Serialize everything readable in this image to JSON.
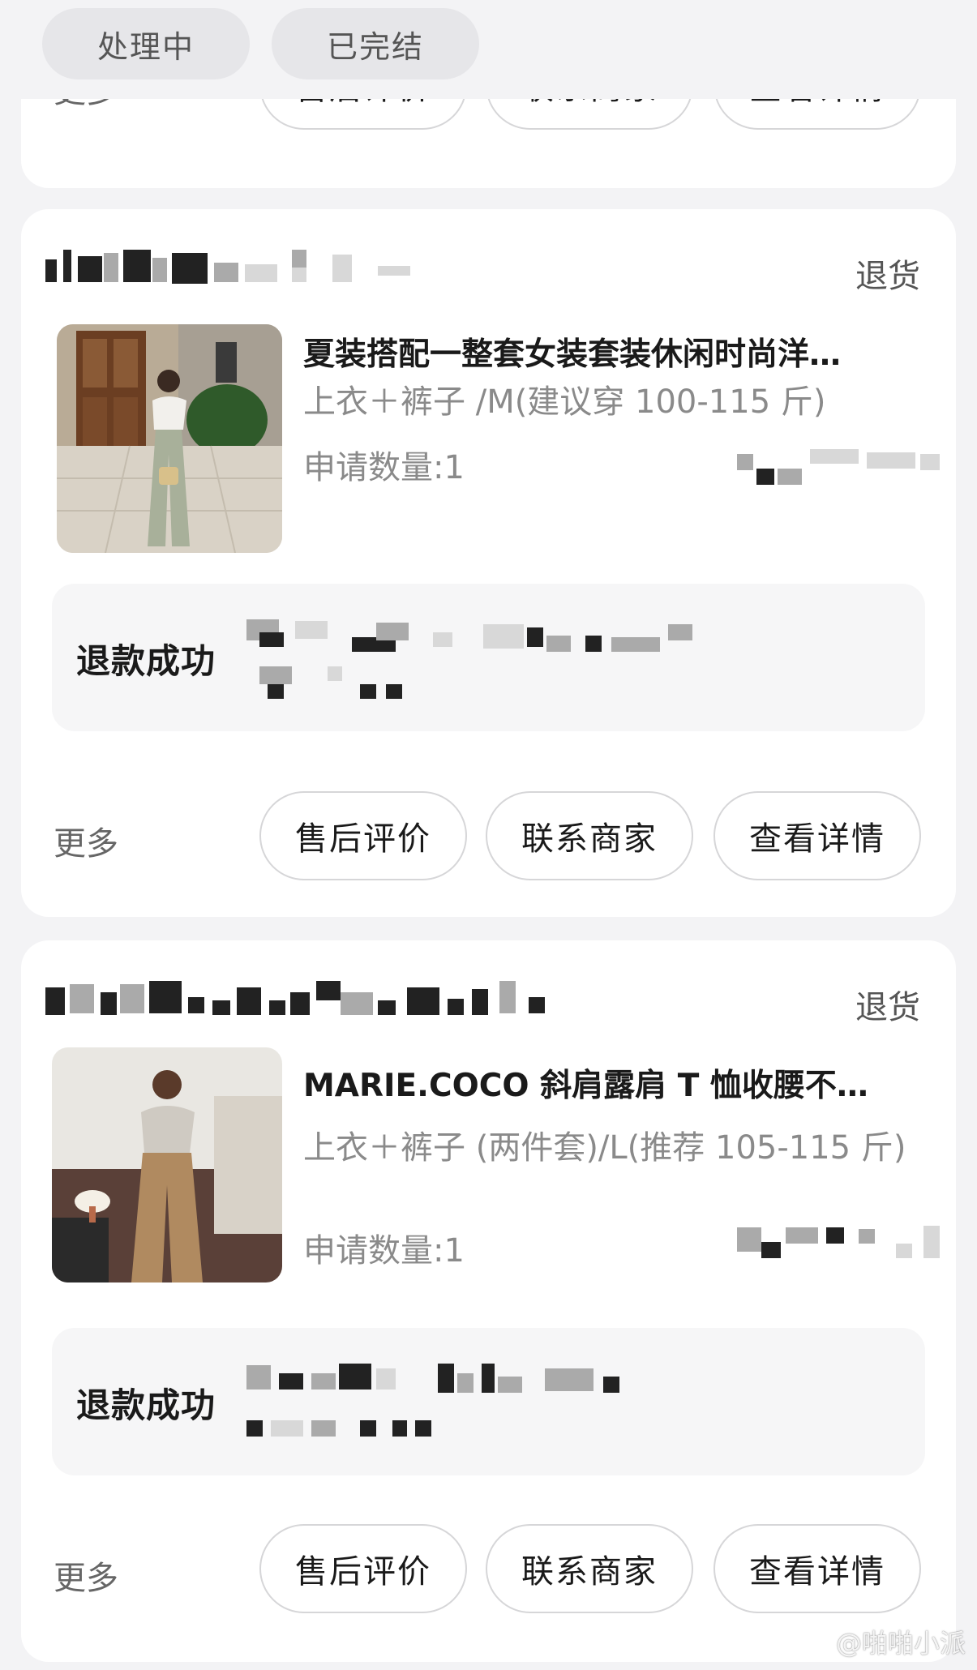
{
  "tabs": [
    {
      "label": "处理中"
    },
    {
      "label": "已完结"
    }
  ],
  "orders": [
    {
      "actions": {
        "more": "更多",
        "review": "售后评价",
        "contact": "联系商家",
        "detail": "查看详情"
      }
    },
    {
      "tag": "退货",
      "product": {
        "title": "夏装搭配一整套女装套装休闲时尚洋…",
        "spec": "上衣＋裤子 /M(建议穿 100-115 斤)",
        "qty": "申请数量:1"
      },
      "refund_status": "退款成功",
      "actions": {
        "more": "更多",
        "review": "售后评价",
        "contact": "联系商家",
        "detail": "查看详情"
      }
    },
    {
      "tag": "退货",
      "product": {
        "title": "MARIE.COCO 斜肩露肩 T 恤收腰不…",
        "spec": "上衣＋裤子 (两件套)/L(推荐 105-115 斤)",
        "qty": "申请数量:1"
      },
      "refund_status": "退款成功",
      "actions": {
        "more": "更多",
        "review": "售后评价",
        "contact": "联系商家",
        "detail": "查看详情"
      }
    }
  ],
  "watermark": "@啪啪小派"
}
